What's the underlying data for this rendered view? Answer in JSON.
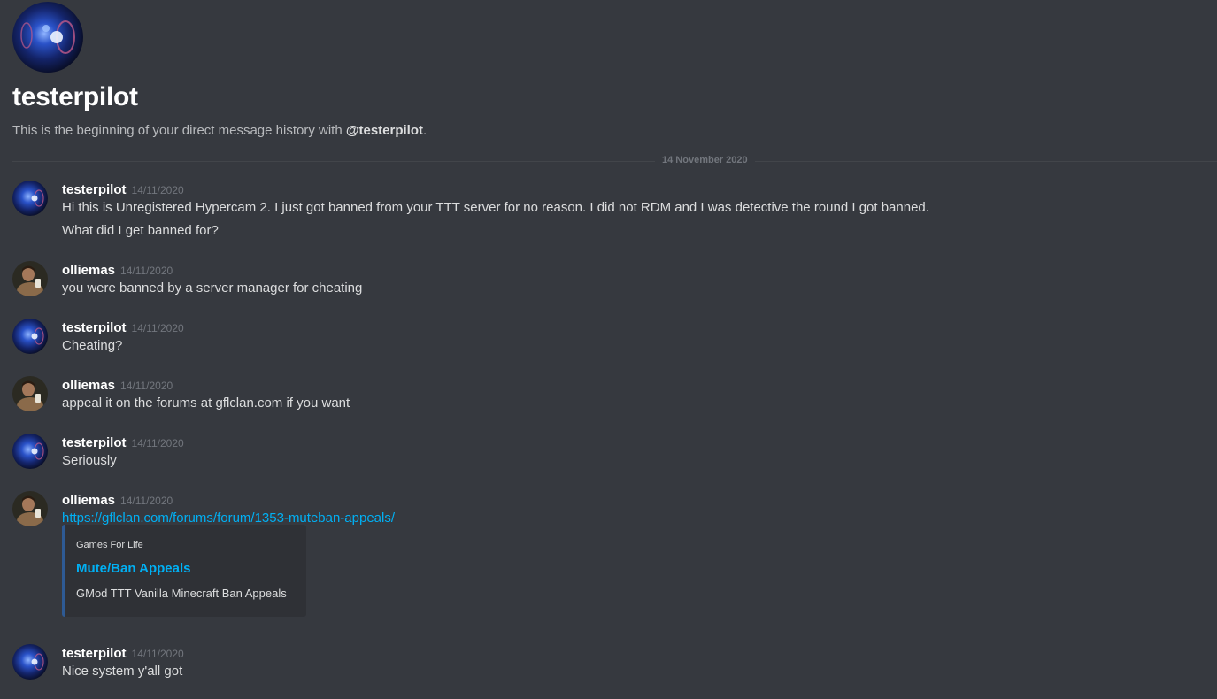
{
  "header": {
    "name": "testerpilot",
    "intro_prefix": "This is the beginning of your direct message history with ",
    "intro_user": "@testerpilot",
    "intro_suffix": "."
  },
  "divider": {
    "date": "14 November 2020"
  },
  "messages": [
    {
      "author": "testerpilot",
      "time": "14/11/2020",
      "avatar_icon": "nebula-avatar-icon",
      "lines": [
        "Hi this is Unregistered Hypercam 2. I just got banned from your TTT server for no reason. I did not RDM and I was detective the round I got banned.",
        "What did I get banned for?"
      ]
    },
    {
      "author": "olliemas",
      "time": "14/11/2020",
      "avatar_icon": "person-avatar-icon",
      "lines": [
        "you were banned by a server manager for cheating"
      ]
    },
    {
      "author": "testerpilot",
      "time": "14/11/2020",
      "avatar_icon": "nebula-avatar-icon",
      "lines": [
        "Cheating?"
      ]
    },
    {
      "author": "olliemas",
      "time": "14/11/2020",
      "avatar_icon": "person-avatar-icon",
      "lines": [
        "appeal it on the forums at gflclan.com if you want"
      ]
    },
    {
      "author": "testerpilot",
      "time": "14/11/2020",
      "avatar_icon": "nebula-avatar-icon",
      "lines": [
        "Seriously"
      ]
    },
    {
      "author": "olliemas",
      "time": "14/11/2020",
      "avatar_icon": "person-avatar-icon",
      "link": "https://gflclan.com/forums/forum/1353-muteban-appeals/",
      "embed": {
        "provider": "Games For Life",
        "title": "Mute/Ban Appeals",
        "description": "GMod TTT Vanilla Minecraft Ban Appeals"
      }
    },
    {
      "author": "testerpilot",
      "time": "14/11/2020",
      "avatar_icon": "nebula-avatar-icon",
      "lines": [
        "Nice system y'all got"
      ]
    }
  ],
  "colors": {
    "background": "#36393f",
    "link": "#00b0f4",
    "embed_background": "#2f3136",
    "embed_accent": "#2e5a94"
  }
}
